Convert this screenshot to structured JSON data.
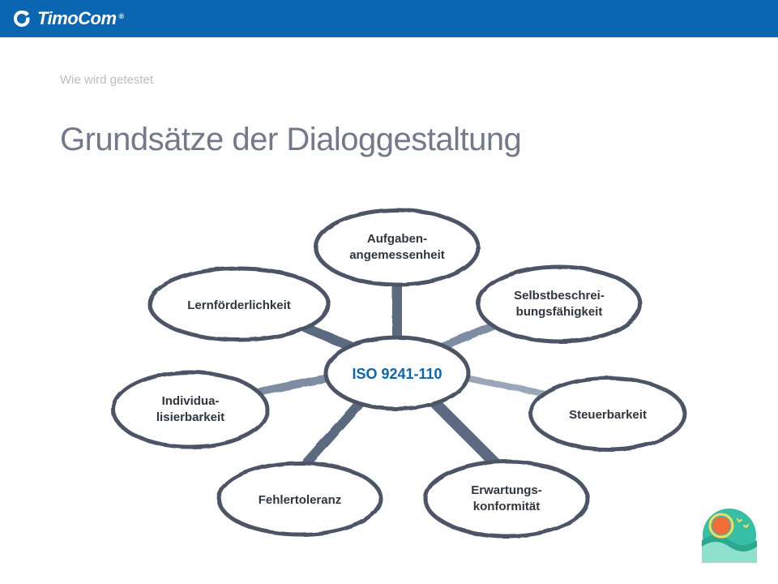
{
  "brand": {
    "name": "TimoCom",
    "reg": "®"
  },
  "subheading": "Wie wird getestet",
  "heading": "Grundsätze der Dialoggestaltung",
  "diagram": {
    "center": "ISO 9241-110",
    "nodes": {
      "top": {
        "line1": "Aufgaben-",
        "line2": "angemessenheit"
      },
      "topRight": {
        "line1": "Selbstbeschrei-",
        "line2": "bungsfähigkeit"
      },
      "right": {
        "line1": "Steuerbarkeit",
        "line2": ""
      },
      "botRight": {
        "line1": "Erwartungs-",
        "line2": "konformität"
      },
      "botLeft": {
        "line1": "Fehlertoleranz",
        "line2": ""
      },
      "left": {
        "line1": "Individua-",
        "line2": "lisierbarkeit"
      },
      "topLeft": {
        "line1": "Lernförderlichkeit",
        "line2": ""
      }
    }
  },
  "colors": {
    "headerBg": "#0a66b1",
    "ellipseStroke": "#4b5566",
    "spokeLight": "#9ca8bc",
    "centerText": "#0a66b1",
    "nodeText": "#2f3640",
    "heading": "#72798a",
    "subheading": "#b9bec7"
  }
}
